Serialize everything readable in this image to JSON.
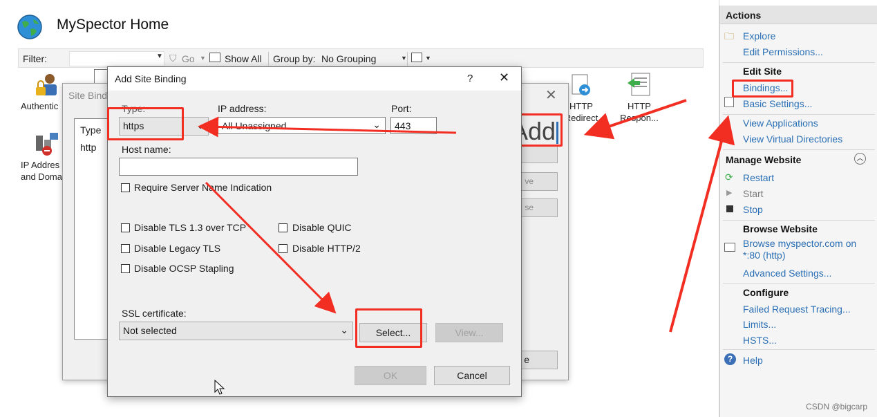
{
  "home": {
    "title": "MySpector Home",
    "filter_label": "Filter:",
    "go_label": "Go",
    "show_all_label": "Show All",
    "group_by_label": "Group by:",
    "group_by_value": "No Grouping",
    "features": [
      {
        "label": "Authentic",
        "icon": "authentication-icon"
      },
      {
        "label": "IP Addres\nand Doma",
        "icon": "ip-domain-icon"
      },
      {
        "label": "HTTP\nRedirect",
        "icon": "http-redirect-icon"
      },
      {
        "label": "HTTP\nRespon...",
        "icon": "http-response-icon"
      }
    ]
  },
  "site_bindings": {
    "title": "Site Bindi",
    "col_type": "Type",
    "row_type": "http",
    "add_big": "Add",
    "edit_partial": "ve",
    "remove_partial": "se",
    "close_partial": "e"
  },
  "add_binding": {
    "title": "Add Site Binding",
    "help": "?",
    "type_label": "Type:",
    "type_value": "https",
    "ip_label": "IP address:",
    "ip_value": "All Unassigned",
    "port_label": "Port:",
    "port_value": "443",
    "host_label": "Host name:",
    "host_value": "",
    "require_sni": "Require Server Name Indication",
    "disable_tls13": "Disable TLS 1.3 over TCP",
    "disable_quic": "Disable QUIC",
    "disable_legacy_tls": "Disable Legacy TLS",
    "disable_http2": "Disable HTTP/2",
    "disable_ocsp": "Disable OCSP Stapling",
    "ssl_label": "SSL certificate:",
    "ssl_value": "Not selected",
    "select_btn": "Select...",
    "view_btn": "View...",
    "ok_btn": "OK",
    "cancel_btn": "Cancel"
  },
  "actions": {
    "header": "Actions",
    "explore": "Explore",
    "edit_permissions": "Edit Permissions...",
    "edit_site": "Edit Site",
    "bindings": "Bindings...",
    "basic_settings": "Basic Settings...",
    "view_applications": "View Applications",
    "view_virtual_dirs": "View Virtual Directories",
    "manage_website": "Manage Website",
    "restart": "Restart",
    "start": "Start",
    "stop": "Stop",
    "browse_website": "Browse Website",
    "browse_link_1": "Browse myspector.com on",
    "browse_link_2": "*:80 (http)",
    "advanced_settings": "Advanced Settings...",
    "configure": "Configure",
    "failed_request": "Failed Request Tracing...",
    "limits": "Limits...",
    "hsts": "HSTS...",
    "help": "Help"
  },
  "watermark": "CSDN @bigcarp",
  "colors": {
    "annotation_red": "#f22d22",
    "link_blue": "#2a6fb5"
  }
}
